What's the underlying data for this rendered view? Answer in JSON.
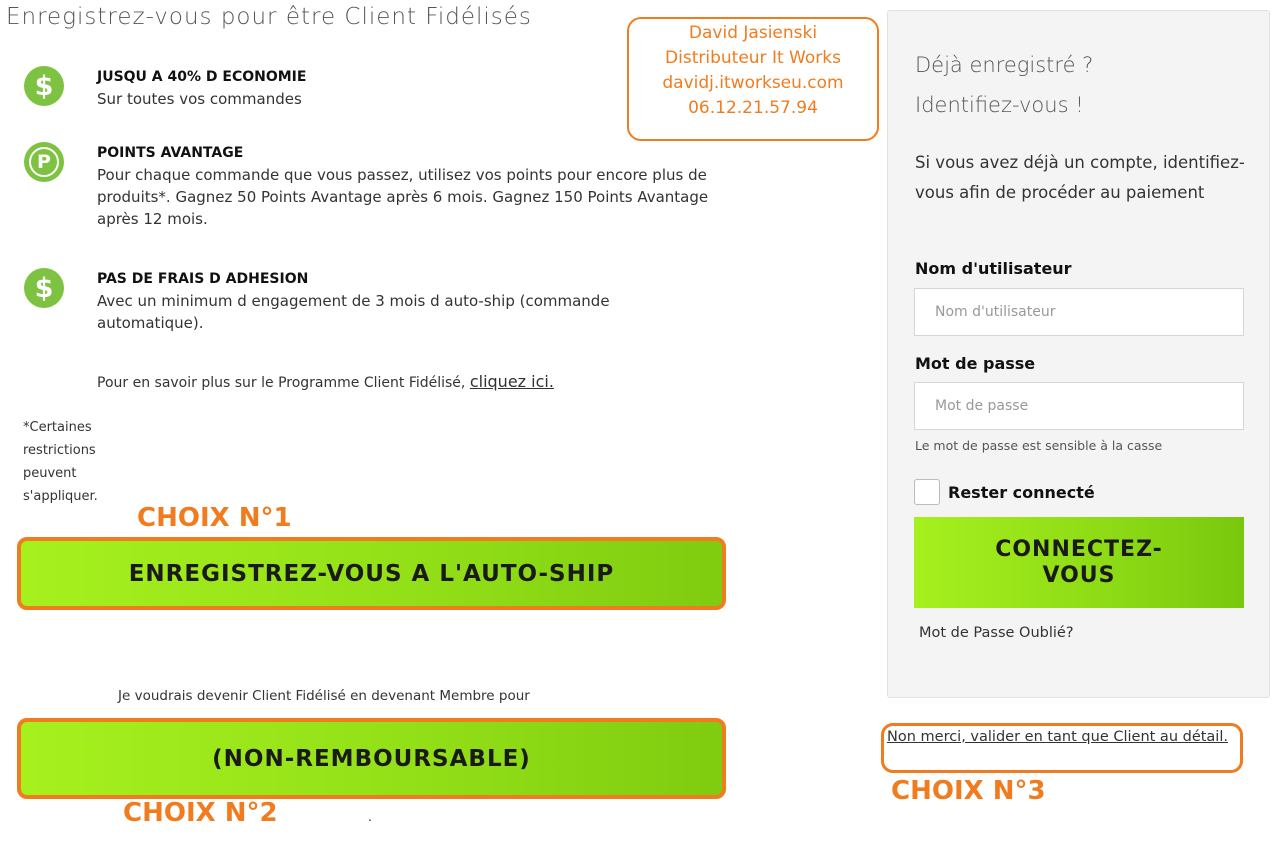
{
  "page": {
    "heading": "Enregistrez-vous pour être Client Fidélisés"
  },
  "contact": {
    "name": "David Jasienski",
    "role": "Distributeur It Works",
    "website": "davidj.itworkseu.com",
    "phone": "06.12.21.57.94"
  },
  "benefits": [
    {
      "icon": "dollar-icon",
      "icon_glyph": "$",
      "title": "JUSQU A 40% D ECONOMIE",
      "text": "Sur toutes vos commandes"
    },
    {
      "icon": "points-icon",
      "icon_glyph": "P",
      "title": "POINTS AVANTAGE",
      "text": "Pour chaque commande que vous passez, utilisez vos points pour encore plus de produits*. Gagnez 50 Points Avantage après 6 mois. Gagnez 150 Points Avantage après 12 mois."
    },
    {
      "icon": "dollar-icon",
      "icon_glyph": "$",
      "title": "PAS DE FRAIS D ADHESION",
      "text": "Avec un minimum d engagement de 3 mois d auto-ship (commande automatique)."
    }
  ],
  "more_info": {
    "text": "Pour en savoir plus sur le Programme Client Fidélisé,",
    "link": "cliquez ici."
  },
  "footnote": "*Certaines restrictions peuvent s'appliquer.",
  "choices": {
    "choice1_label": "CHOIX N°1",
    "choice1_button": "ENREGISTREZ-VOUS A L'AUTO-SHIP",
    "member_text": "Je voudrais devenir Client Fidélisé en devenant Membre pour",
    "choice2_button": "(NON-REMBOURSABLE)",
    "choice2_label": "CHOIX N°2",
    "stray_dot": ".",
    "choice3_label": "CHOIX N°3",
    "choice3_link": "Non merci, valider en tant que Client au détail."
  },
  "login": {
    "title_line1": "Déjà enregistré ?",
    "title_line2": "Identifiez-vous !",
    "description": "Si vous avez déjà un compte, identifiez-vous afin de procéder au paiement",
    "username_label": "Nom d'utilisateur",
    "username_placeholder": "Nom d'utilisateur",
    "password_label": "Mot de passe",
    "password_placeholder": "Mot de passe",
    "case_note": "Le mot de passe est sensible à la casse",
    "remember_label": "Rester connecté",
    "connect_button": "CONNECTEZ-VOUS",
    "forgot_link": "Mot de Passe Oublié?"
  },
  "colors": {
    "accent_orange": "#f07c1f",
    "button_green": "#93e018",
    "icon_green": "#7ec242"
  }
}
